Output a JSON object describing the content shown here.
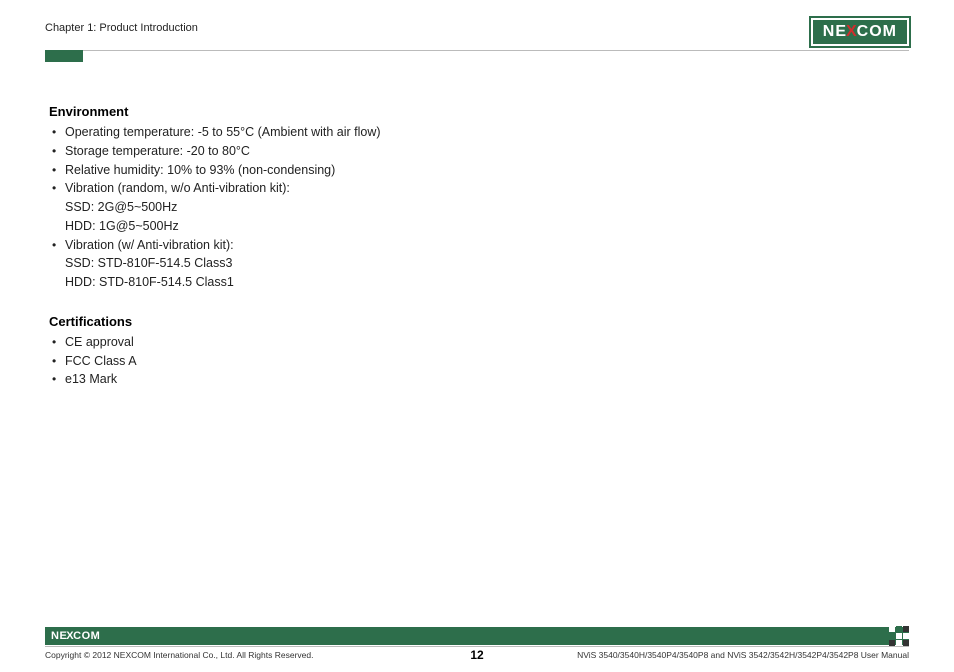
{
  "header": {
    "chapter": "Chapter 1: Product Introduction",
    "logo_parts": {
      "pre": "NE",
      "x": "X",
      "post": "COM"
    }
  },
  "sections": [
    {
      "title": "Environment",
      "items": [
        {
          "text": "Operating temperature: -5 to 55°C (Ambient with air flow)"
        },
        {
          "text": "Storage temperature: -20 to 80°C"
        },
        {
          "text": "Relative humidity: 10% to 93% (non-condensing)"
        },
        {
          "text": "Vibration (random, w/o Anti-vibration kit):",
          "sublines": [
            "SSD: 2G@5~500Hz",
            "HDD: 1G@5~500Hz"
          ]
        },
        {
          "text": "Vibration (w/ Anti-vibration kit):",
          "sublines": [
            "SSD: STD-810F-514.5 Class3",
            "HDD: STD-810F-514.5 Class1"
          ]
        }
      ]
    },
    {
      "title": "Certifications",
      "items": [
        {
          "text": "CE approval"
        },
        {
          "text": "FCC Class A"
        },
        {
          "text": "e13 Mark"
        }
      ]
    }
  ],
  "footer": {
    "logo_parts": {
      "pre": "NE",
      "x": "X",
      "post": "COM"
    },
    "copyright": "Copyright © 2012 NEXCOM International Co., Ltd. All Rights Reserved.",
    "page_number": "12",
    "model_info": "NViS 3540/3540H/3540P4/3540P8 and NViS 3542/3542H/3542P4/3542P8 User Manual"
  }
}
